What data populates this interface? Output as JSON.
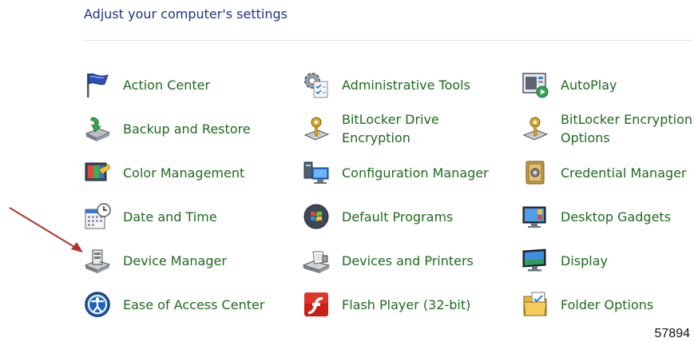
{
  "header": {
    "title": "Adjust your computer's settings"
  },
  "items": [
    {
      "label": "Action Center",
      "icon": "flag-icon"
    },
    {
      "label": "Administrative Tools",
      "icon": "admin-tools-icon"
    },
    {
      "label": "AutoPlay",
      "icon": "autoplay-icon"
    },
    {
      "label": "Backup and Restore",
      "icon": "backup-icon"
    },
    {
      "label": "BitLocker Drive Encryption",
      "icon": "bitlocker-key-icon"
    },
    {
      "label": "BitLocker Encryption Options",
      "icon": "bitlocker-key-icon"
    },
    {
      "label": "Color Management",
      "icon": "color-management-icon"
    },
    {
      "label": "Configuration Manager",
      "icon": "configuration-manager-icon"
    },
    {
      "label": "Credential Manager",
      "icon": "credential-safe-icon"
    },
    {
      "label": "Date and Time",
      "icon": "calendar-clock-icon"
    },
    {
      "label": "Default Programs",
      "icon": "windows-orb-icon"
    },
    {
      "label": "Desktop Gadgets",
      "icon": "desktop-gadgets-icon"
    },
    {
      "label": "Device Manager",
      "icon": "device-manager-icon"
    },
    {
      "label": "Devices and Printers",
      "icon": "printer-icon"
    },
    {
      "label": "Display",
      "icon": "monitor-icon"
    },
    {
      "label": "Ease of Access Center",
      "icon": "ease-of-access-icon"
    },
    {
      "label": "Flash Player (32-bit)",
      "icon": "flash-player-icon"
    },
    {
      "label": "Folder Options",
      "icon": "folder-icon"
    }
  ],
  "figure_number": "57894",
  "colors": {
    "link": "#1e6a1e",
    "header": "#1e3287",
    "arrow": "#b3342f"
  }
}
